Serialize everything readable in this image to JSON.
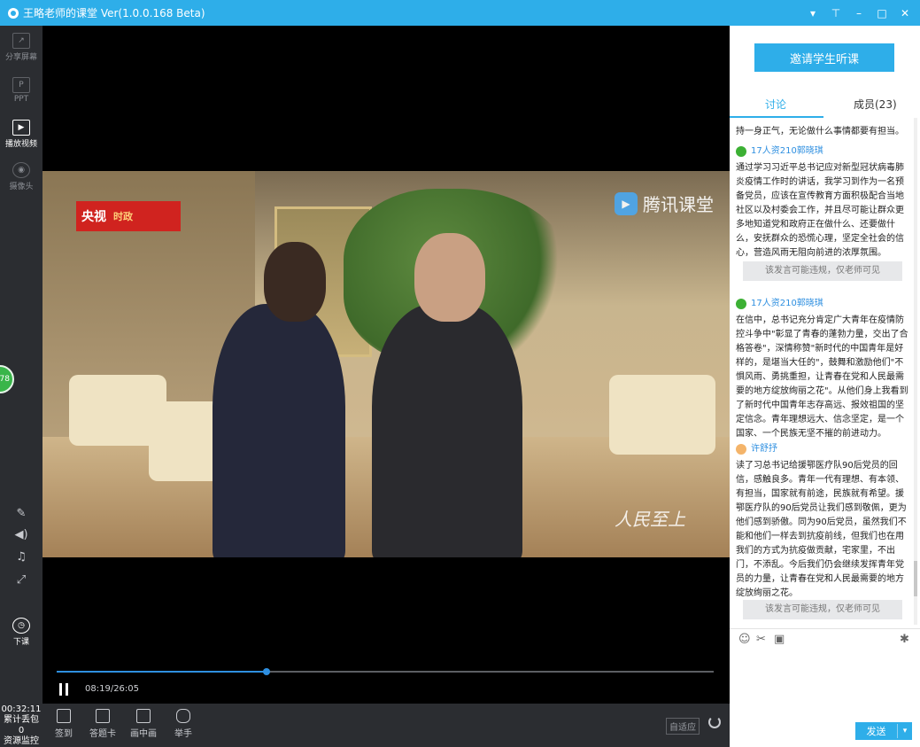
{
  "window": {
    "title": "王略老师的课堂 Ver(1.0.0.168 Beta)"
  },
  "left_tools": [
    {
      "label": "分享屏幕"
    },
    {
      "label": "PPT"
    },
    {
      "label": "播放视频"
    },
    {
      "label": "摄像头"
    }
  ],
  "left_controls": {
    "end_class": "下课",
    "green_badge": "78"
  },
  "status": {
    "time": "00:32:11",
    "lost": "累计丢包",
    "lost_value": "0",
    "monitor": "资源监控"
  },
  "player": {
    "timecode": "08:19/26:05",
    "progress": 0.319
  },
  "video_overlays": {
    "cctv": "央视",
    "cctv2": "时政",
    "tencent": "腾讯课堂",
    "rm": "人民至上"
  },
  "bottom_buttons": [
    {
      "label": "签到"
    },
    {
      "label": "答题卡"
    },
    {
      "label": "画中画"
    },
    {
      "label": "举手"
    }
  ],
  "bottom_right": {
    "fit": "自适应"
  },
  "side": {
    "invite": "邀请学生听课",
    "tab_discuss": "讨论",
    "tab_members": "成员(23)",
    "partial_top": "持一身正气，无论做什么事情都要有担当。",
    "messages": [
      {
        "author": "17人资210郭晓琪",
        "text": "通过学习习近平总书记应对新型冠状病毒肺炎疫情工作时的讲话，我学习到作为一名预备党员，应该在宣传教育方面积极配合当地社区以及村委会工作，并且尽可能让群众更多地知道党和政府正在做什么、还要做什么，安抚群众的恐慌心理，坚定全社会的信心，营造风雨无阻向前进的浓厚氛围。"
      },
      {
        "author": "17人资210郭晓琪",
        "text": "在信中，总书记充分肯定广大青年在疫情防控斗争中\"彰显了青春的蓬勃力量，交出了合格答卷\"，深情称赞\"新时代的中国青年是好样的，是堪当大任的\"，鼓舞和激励他们\"不惧风雨、勇挑重担，让青春在党和人民最需要的地方绽放绚丽之花\"。从他们身上我看到了新时代中国青年志存高远、报效祖国的坚定信念。青年理想远大、信念坚定，是一个国家、一个民族无坚不摧的前进动力。"
      },
      {
        "author": "许舒抒",
        "text": "读了习总书记给援鄂医疗队90后党员的回信，感触良多。青年一代有理想、有本领、有担当，国家就有前途，民族就有希望。援鄂医疗队的90后党员让我们感到敬佩，更为他们感到骄傲。同为90后党员，虽然我们不能和他们一样去到抗疫前线，但我们也在用我们的方式为抗疫做贡献，宅家里，不出门，不添乱。今后我们仍会继续发挥青年党员的力量，让青春在党和人民最需要的地方绽放绚丽之花。"
      }
    ],
    "warn": "该发言可能违规，仅老师可见",
    "send": "发送"
  }
}
